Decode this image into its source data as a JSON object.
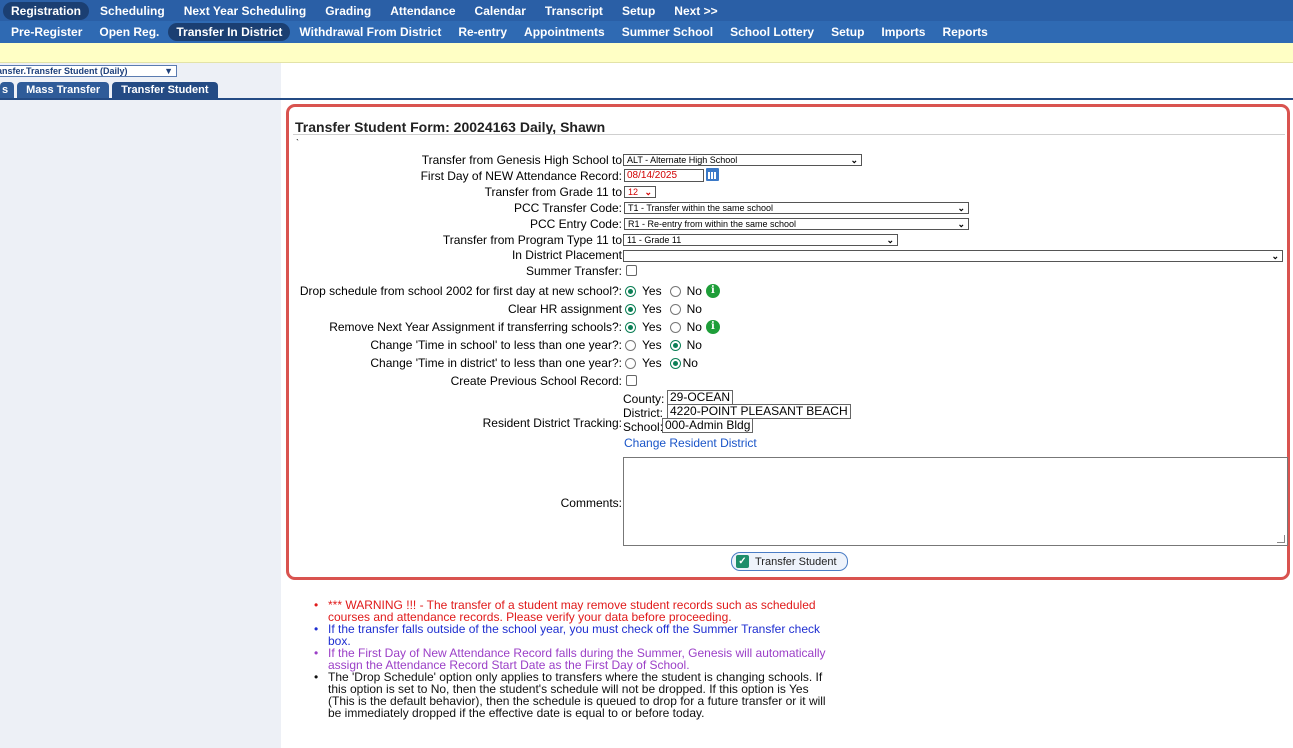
{
  "top_nav": [
    "Registration",
    "Scheduling",
    "Next Year Scheduling",
    "Grading",
    "Attendance",
    "Calendar",
    "Transcript",
    "Setup",
    "Next >>"
  ],
  "sub_nav": [
    "Pre-Register",
    "Open Reg.",
    "Transfer In District",
    "Withdrawal From District",
    "Re-entry",
    "Appointments",
    "Summer School",
    "School Lottery",
    "Setup",
    "Imports",
    "Reports"
  ],
  "screen_select": "ansfer.Transfer Student (Daily)",
  "sub_tabs": [
    "s",
    "Mass Transfer",
    "Transfer Student"
  ],
  "form": {
    "title": "Transfer Student Form: 20024163 Daily, Shawn",
    "tick": "`",
    "transfer_school_label": "Transfer from Genesis High School to",
    "transfer_school_value": "ALT - Alternate High School",
    "first_day_label": "First Day of NEW Attendance Record:",
    "first_day_value": "08/14/2025",
    "grade_label": "Transfer from Grade 11 to",
    "grade_value": "12",
    "pcc_transfer_label": "PCC Transfer Code:",
    "pcc_transfer_value": "T1 - Transfer within the same school",
    "pcc_entry_label": "PCC Entry Code:",
    "pcc_entry_value": "R1 - Re-entry from within the same school",
    "program_label": "Transfer from Program Type 11 to",
    "program_value": "11 - Grade 11",
    "placement_label": "In District Placement",
    "placement_value": "",
    "summer_label": "Summer Transfer:",
    "drop_schedule_label": "Drop schedule from school 2002 for first day at new school?:",
    "clear_hr_label": "Clear HR assignment",
    "remove_next_year_label": "Remove Next Year Assignment if transferring schools?:",
    "time_school_label": "Change 'Time in school' to less than one year?:",
    "time_district_label": "Change 'Time in district' to less than one year?:",
    "create_prev_label": "Create Previous School Record:",
    "yes": "Yes",
    "no": "No",
    "resident_label": "Resident District Tracking:",
    "county_label": "County:",
    "county_value": "29-OCEAN",
    "district_label": "District:",
    "district_value": "4220-POINT PLEASANT BEACH",
    "school_label": "School:",
    "school_value": "000-Admin Bldg",
    "change_resident_link": "Change Resident District",
    "comments_label": "Comments:",
    "submit_label": "Transfer Student"
  },
  "notes": [
    "*** WARNING !!! - The transfer of a student may remove student records such as scheduled courses and attendance records. Please verify your data before proceeding.",
    "If the transfer falls outside of the school year, you must check off the Summer Transfer check box.",
    "If the First Day of New Attendance Record falls during the Summer, Genesis will automatically assign the Attendance Record Start Date as the First Day of School.",
    "The 'Drop Schedule' option only applies to transfers where the student is changing schools. If this option is set to No, then the student's schedule will not be dropped. If this option is Yes (This is the default behavior), then the schedule is queued to drop for a future transfer or it will be immediately dropped if the effective date is equal to or before today."
  ],
  "colors": {
    "nav_bar": "#2a5fa6",
    "highlight_border": "#d9534f",
    "radio_selected": "#0b7f55",
    "info_icon": "#1e9e39"
  }
}
